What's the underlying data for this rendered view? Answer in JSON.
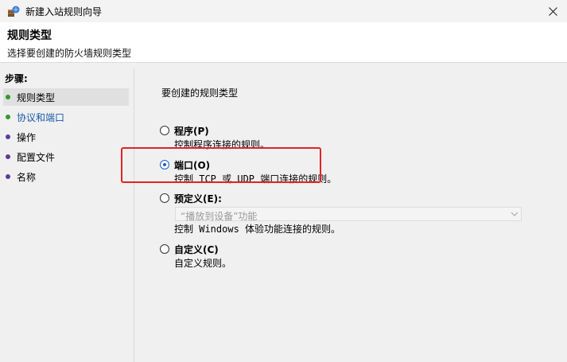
{
  "window": {
    "title": "新建入站规则向导",
    "close_icon": "close-icon"
  },
  "header": {
    "title": "规则类型",
    "subtitle": "选择要创建的防火墙规则类型"
  },
  "steps": {
    "title": "步骤:",
    "items": [
      {
        "label": "规则类型",
        "color": "#2e9a2e",
        "active": true
      },
      {
        "label": "协议和端口",
        "color": "#2e9a2e",
        "link": true
      },
      {
        "label": "操作",
        "color": "#5f3a9a"
      },
      {
        "label": "配置文件",
        "color": "#5f3a9a"
      },
      {
        "label": "名称",
        "color": "#5f3a9a"
      }
    ]
  },
  "main": {
    "prompt": "要创建的规则类型",
    "options": [
      {
        "label": "程序(P)",
        "desc": "控制程序连接的规则。",
        "checked": false
      },
      {
        "label": "端口(O)",
        "desc": "控制 TCP 或 UDP 端口连接的规则。",
        "checked": true
      },
      {
        "label": "预定义(E):",
        "desc": "控制 Windows 体验功能连接的规则。",
        "checked": false
      },
      {
        "label": "自定义(C)",
        "desc": "自定义规则。",
        "checked": false
      }
    ],
    "predefined_select": {
      "value": "“播放到设备”功能",
      "disabled": true
    }
  },
  "colors": {
    "highlight": "#e02424",
    "radio_selected": "#1d5fbf",
    "link": "#1a5aa8"
  }
}
